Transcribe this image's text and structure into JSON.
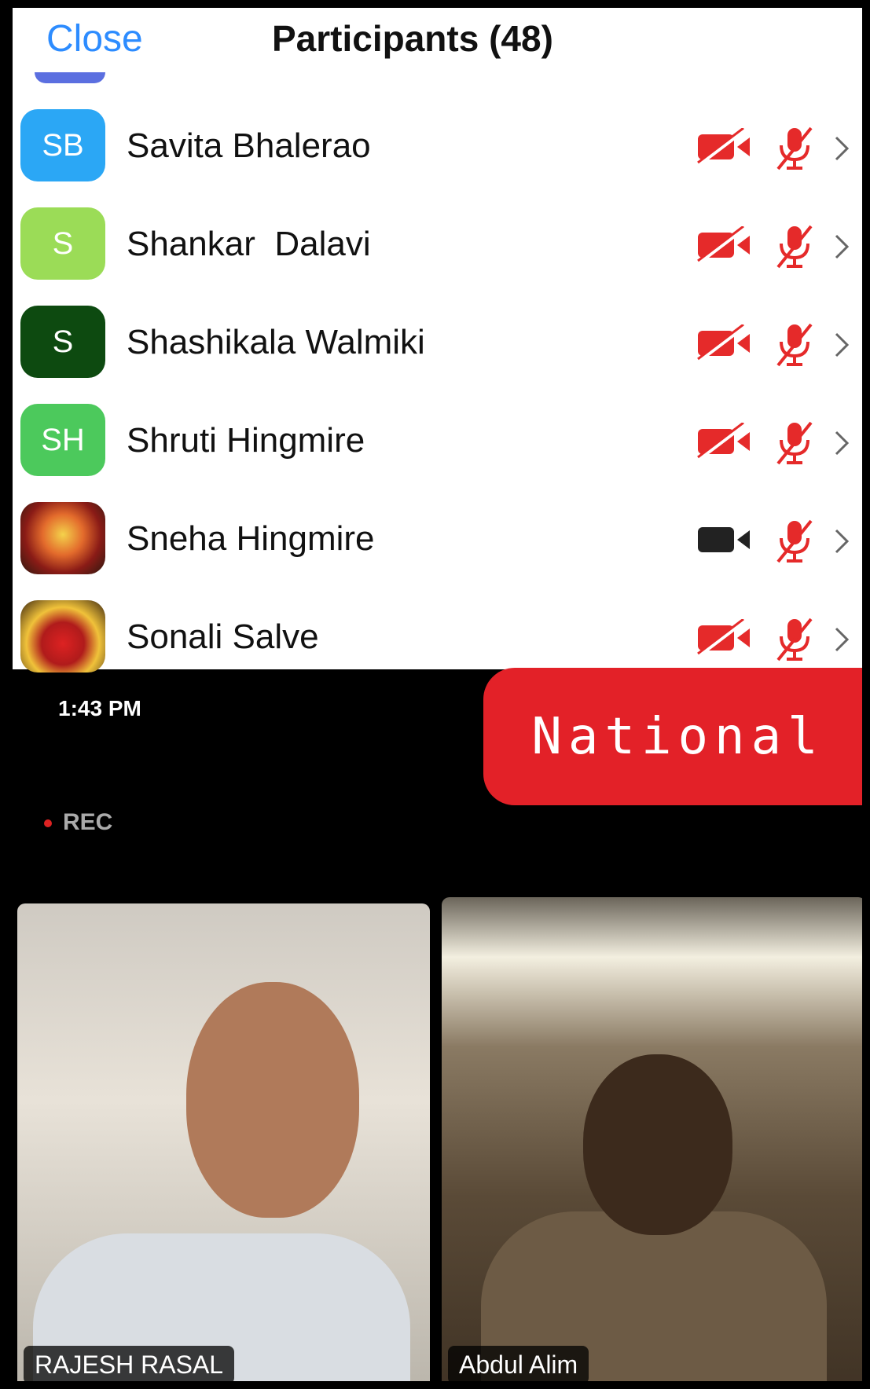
{
  "header": {
    "close_label": "Close",
    "title": "Participants (48)"
  },
  "participants": [
    {
      "initials": "SB",
      "name": "Savita Bhalerao",
      "avatar_color": "#2ba7f5",
      "video_on": false,
      "mic_muted": true
    },
    {
      "initials": "S",
      "name": "Shankar  Dalavi",
      "avatar_color": "#9bdc57",
      "video_on": false,
      "mic_muted": true
    },
    {
      "initials": "S",
      "name": "Shashikala Walmiki",
      "avatar_color": "#0d4a10",
      "video_on": false,
      "mic_muted": true
    },
    {
      "initials": "SH",
      "name": "Shruti Hingmire",
      "avatar_color": "#4cc95c",
      "video_on": false,
      "mic_muted": true
    },
    {
      "initials": "",
      "name": "Sneha Hingmire",
      "avatar_color": "photo",
      "video_on": true,
      "mic_muted": true
    },
    {
      "initials": "",
      "name": "Sonali Salve",
      "avatar_color": "photo2",
      "video_on": false,
      "mic_muted": true
    }
  ],
  "meeting": {
    "time": "1:43 PM",
    "banner": "National",
    "rec_label": "REC",
    "videos": [
      {
        "label": "RAJESH RASAL"
      },
      {
        "label": "Abdul Alim"
      }
    ]
  },
  "colors": {
    "accent": "#2d8cff",
    "muted_red": "#e52a2a",
    "banner_red": "#e32128"
  }
}
